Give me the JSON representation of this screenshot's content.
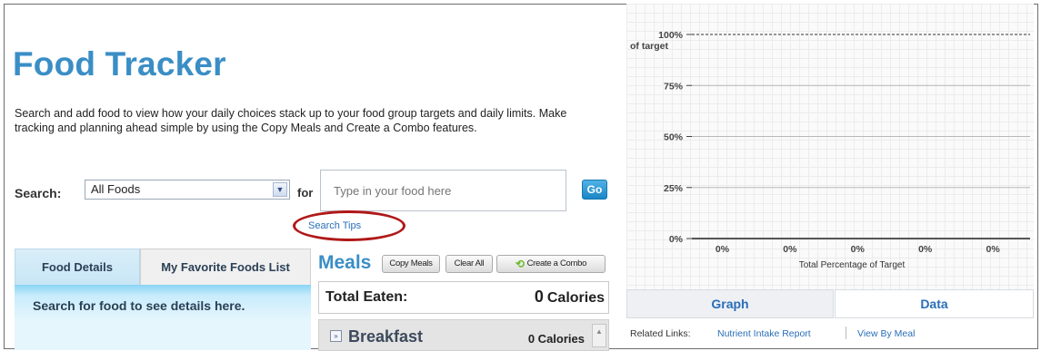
{
  "page": {
    "title": "Food Tracker",
    "intro": "Search and add food to view how your daily choices stack up to your food group targets and daily limits. Make tracking and planning ahead simple by using the Copy Meals and Create a Combo features."
  },
  "search": {
    "label": "Search:",
    "category_value": "All Foods",
    "for_label": "for",
    "placeholder": "Type in your food here",
    "go_label": "Go",
    "tips_link": "Search Tips"
  },
  "tabs": {
    "food_details": "Food Details",
    "favorites": "My Favorite Foods List"
  },
  "details": {
    "message": "Search for food to see details here."
  },
  "meals": {
    "title": "Meals",
    "copy_label": "Copy Meals",
    "clear_label": "Clear All",
    "combo_label": "Create a Combo",
    "total_label": "Total Eaten:",
    "total_number": "0",
    "total_unit": "Calories",
    "breakfast_label": "Breakfast",
    "breakfast_calories": "0 Calories"
  },
  "chart_data": {
    "type": "bar",
    "ylabel": "of target",
    "xlabel": "Total Percentage of Target",
    "y_ticks": [
      "0%",
      "25%",
      "50%",
      "75%",
      "100%"
    ],
    "ylim": [
      0,
      100
    ],
    "reference_line": 100,
    "categories": [
      "",
      "",
      "",
      "",
      ""
    ],
    "values": [
      0,
      0,
      0,
      0,
      0
    ],
    "value_labels": [
      "0%",
      "0%",
      "0%",
      "0%",
      "0%"
    ],
    "grid": true
  },
  "graph_tabs": {
    "graph": "Graph",
    "data": "Data"
  },
  "related": {
    "label": "Related Links:",
    "nutrient_link": "Nutrient Intake Report",
    "meal_link": "View By Meal"
  },
  "colors": {
    "accent": "#3a8ec6",
    "link": "#2a6eb8",
    "highlight_circle": "#b01818"
  }
}
